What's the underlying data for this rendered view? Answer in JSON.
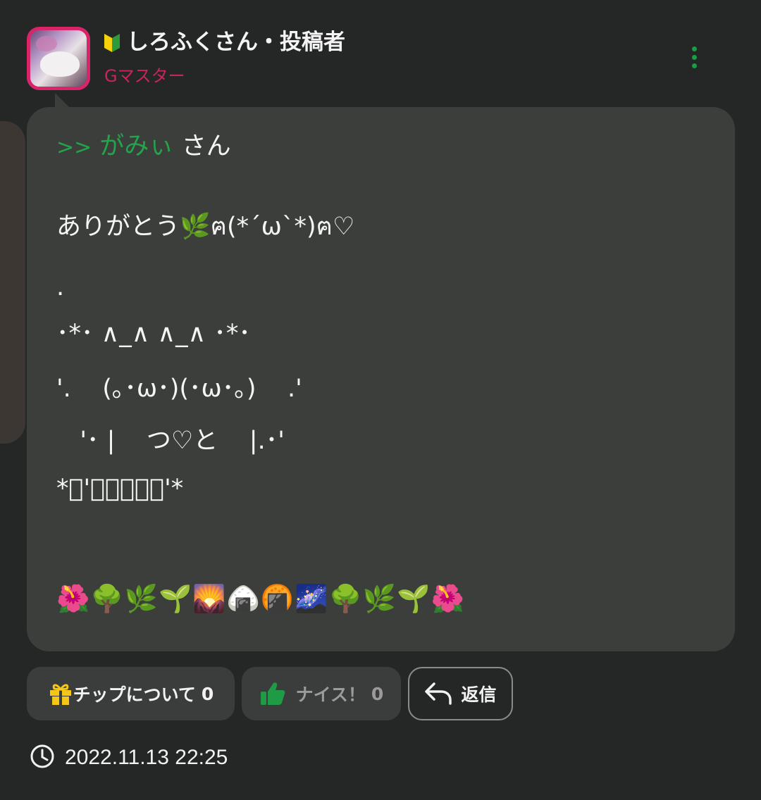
{
  "header": {
    "username": "しろふくさん・投稿者",
    "user_title": "Gマスター",
    "beginner_icon": "beginner-mark-icon",
    "more_icon": "more-vertical-icon"
  },
  "comment": {
    "mention_prefix": ">>",
    "mention_name": "がみぃ",
    "mention_suffix": " さん",
    "lines": [
      "ありがとう🌿ฅ(*´ω`*)ฅ♡",
      ".",
      "･*･ ∧_∧ ∧_∧ ･*･",
      "'.    (｡･ω･)(･ω･｡)    .'",
      "   '･ |    つ♡と    |.･'",
      "*ﾟ'･｡｡･ﾟ'*"
    ],
    "emoji_line": "🌺🌳🌿🌱🌄🍙🍘🌌🌳🌿🌱🌺"
  },
  "actions": {
    "tip_label": "チップについて",
    "tip_count": "0",
    "nice_label": "ナイス！",
    "nice_count": "0",
    "reply_label": "返信"
  },
  "timestamp": "2022.11.13 22:25",
  "colors": {
    "background": "#242726",
    "bubble": "#3b3e3b",
    "accent_green": "#23a34a",
    "title_pink": "#c8245f",
    "gift_yellow": "#f5c518"
  }
}
